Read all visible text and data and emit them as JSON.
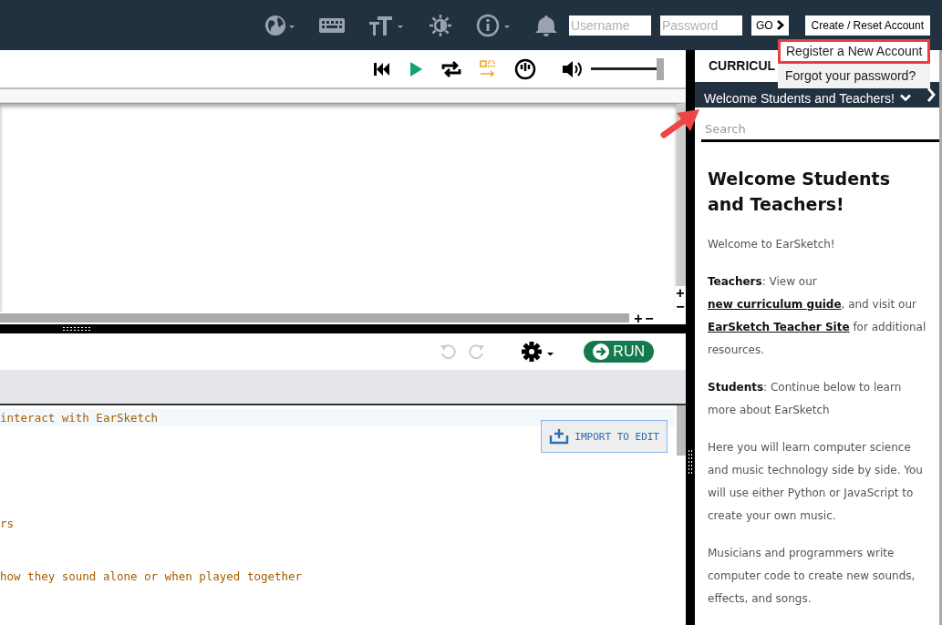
{
  "top_bar": {
    "username": {
      "placeholder": "Username"
    },
    "password": {
      "placeholder": "Password"
    },
    "go_button": "GO",
    "account_button": "Create / Reset Account"
  },
  "account_menu": [
    {
      "label": "Register a New Account",
      "highlighted": true
    },
    {
      "label": "Forgot your password?",
      "highlighted": false
    }
  ],
  "transport": {
    "volume": {
      "level": 1.0
    }
  },
  "timeline_zoom": {
    "vertical": [
      "+",
      "−"
    ],
    "horizontal": [
      "+",
      "−"
    ]
  },
  "editor": {
    "run_button": "RUN",
    "import_button": "IMPORT TO EDIT",
    "lines": [
      {
        "kind": "code",
        "text": "interact with EarSketch",
        "highlighted": true
      },
      {
        "kind": "blank"
      },
      {
        "kind": "blank"
      },
      {
        "kind": "blank"
      },
      {
        "kind": "blank"
      },
      {
        "kind": "blank"
      },
      {
        "kind": "code",
        "text": "rs",
        "highlighted": false
      },
      {
        "kind": "blank"
      },
      {
        "kind": "blank"
      },
      {
        "kind": "code",
        "text": "how they sound alone or when played together",
        "highlighted": false
      }
    ]
  },
  "curriculum": {
    "header": "CURRICUL",
    "chapter": "Welcome Students and Teachers!",
    "search": {
      "placeholder": "Search"
    },
    "title": "Welcome Students and Teachers!",
    "paragraphs": [
      [
        {
          "kind": "plain",
          "text": "Welcome to EarSketch!"
        }
      ],
      [
        {
          "kind": "bold",
          "text": "Teachers"
        },
        {
          "kind": "plain",
          "text": ": View our "
        },
        {
          "kind": "link",
          "text": "new curriculum guide"
        },
        {
          "kind": "plain",
          "text": ", and visit our "
        },
        {
          "kind": "link",
          "text": "EarSketch Teacher Site"
        },
        {
          "kind": "plain",
          "text": " for additional resources."
        }
      ],
      [
        {
          "kind": "bold",
          "text": "Students"
        },
        {
          "kind": "plain",
          "text": ": Continue below to learn more about EarSketch"
        }
      ],
      [
        {
          "kind": "plain",
          "text": "Here you will learn computer science and music technology side by side. You will use either Python or JavaScript to create your own music."
        }
      ],
      [
        {
          "kind": "plain",
          "text": "Musicians and programmers write computer code to create new sounds, effects, and songs."
        }
      ]
    ]
  }
}
